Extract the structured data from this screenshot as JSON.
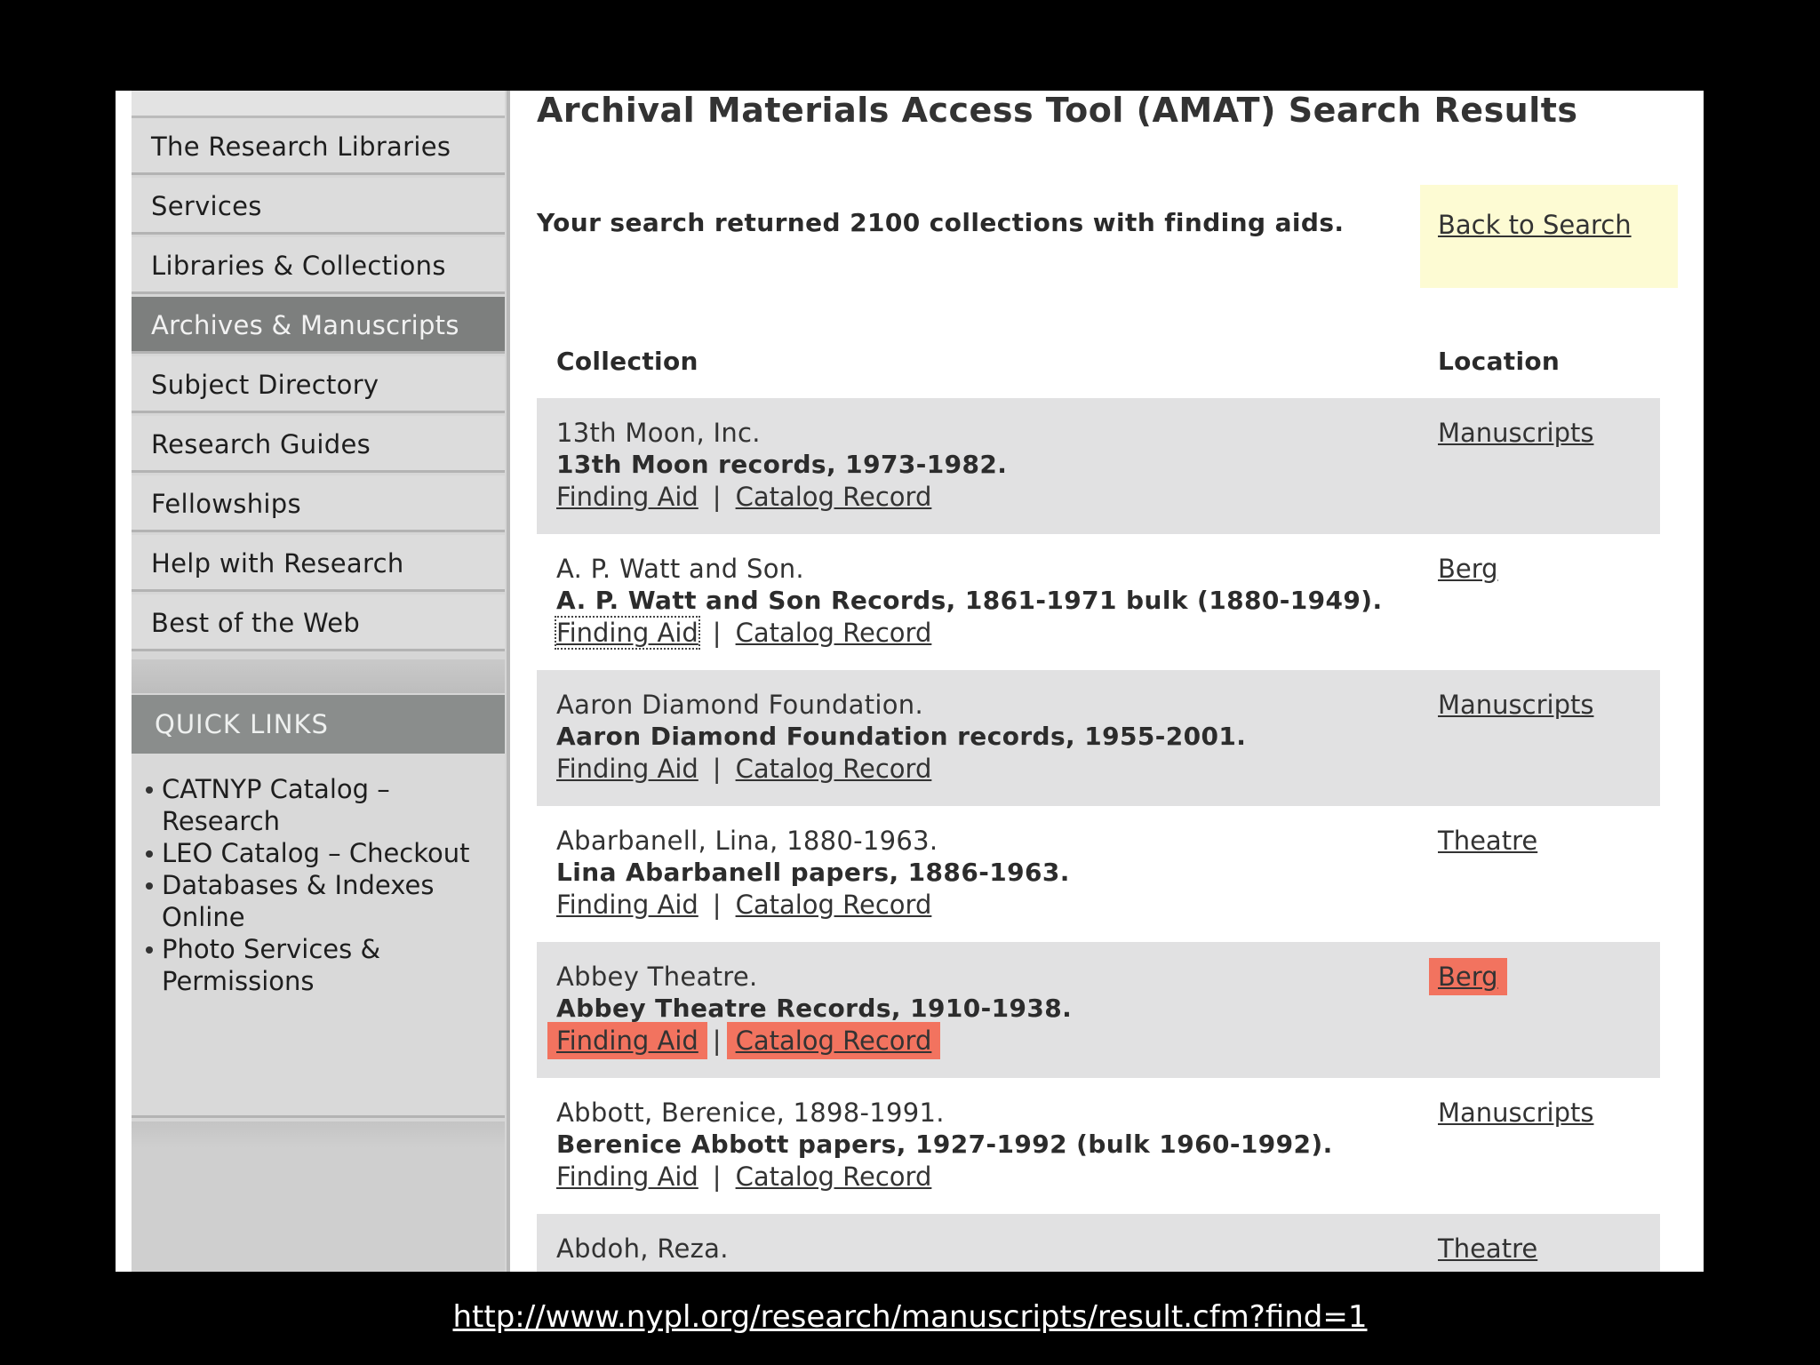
{
  "sidebar": {
    "nav": [
      {
        "label": "The Research Libraries"
      },
      {
        "label": "Services"
      },
      {
        "label": "Libraries & Collections"
      },
      {
        "label": "Archives & Manuscripts",
        "active": true
      },
      {
        "label": "Subject Directory"
      },
      {
        "label": "Research Guides"
      },
      {
        "label": "Fellowships"
      },
      {
        "label": "Help with Research"
      },
      {
        "label": "Best of the Web"
      }
    ],
    "quick_links_title": "QUICK LINKS",
    "quick_links": [
      {
        "line1": "CATNYP Catalog –",
        "line2": "Research"
      },
      {
        "line1": "LEO Catalog – Checkout",
        "line2": ""
      },
      {
        "line1": "Databases & Indexes",
        "line2": "Online"
      },
      {
        "line1": "Photo Services &",
        "line2": "Permissions"
      }
    ]
  },
  "main": {
    "title": "Archival Materials Access Tool (AMAT) Search Results",
    "result_count": "Your search returned 2100 collections with finding aids.",
    "back_link": "Back to Search",
    "columns": {
      "collection": "Collection",
      "location": "Location"
    },
    "link_finding_aid": "Finding Aid",
    "link_separator": "|",
    "link_catalog_record": "Catalog Record",
    "rows": [
      {
        "creator": "13th Moon, Inc.",
        "title": "13th Moon records, 1973-1982.",
        "location": "Manuscripts"
      },
      {
        "creator": "A. P. Watt and Son.",
        "title": "A. P. Watt and Son Records, 1861-1971 bulk (1880-1949).",
        "location": "Berg"
      },
      {
        "creator": "Aaron Diamond Foundation.",
        "title": "Aaron Diamond Foundation records, 1955-2001.",
        "location": "Manuscripts"
      },
      {
        "creator": "Abarbanell, Lina, 1880-1963.",
        "title": "Lina Abarbanell papers, 1886-1963.",
        "location": "Theatre"
      },
      {
        "creator": "Abbey Theatre.",
        "title": "Abbey Theatre Records, 1910-1938.",
        "location": "Berg"
      },
      {
        "creator": "Abbott, Berenice, 1898-1991.",
        "title": "Berenice Abbott papers, 1927-1992 (bulk 1960-1992).",
        "location": "Manuscripts"
      },
      {
        "creator": "Abdoh, Reza.",
        "title": "",
        "location": "Theatre"
      }
    ]
  },
  "caption_url": "http://www.nypl.org/research/manuscripts/result.cfm?find=1",
  "colors": {
    "highlight": "#f2735f",
    "back_box": "#fdfbd3",
    "active_nav": "#7d7f7e",
    "row_shade": "#e1e1e2"
  }
}
